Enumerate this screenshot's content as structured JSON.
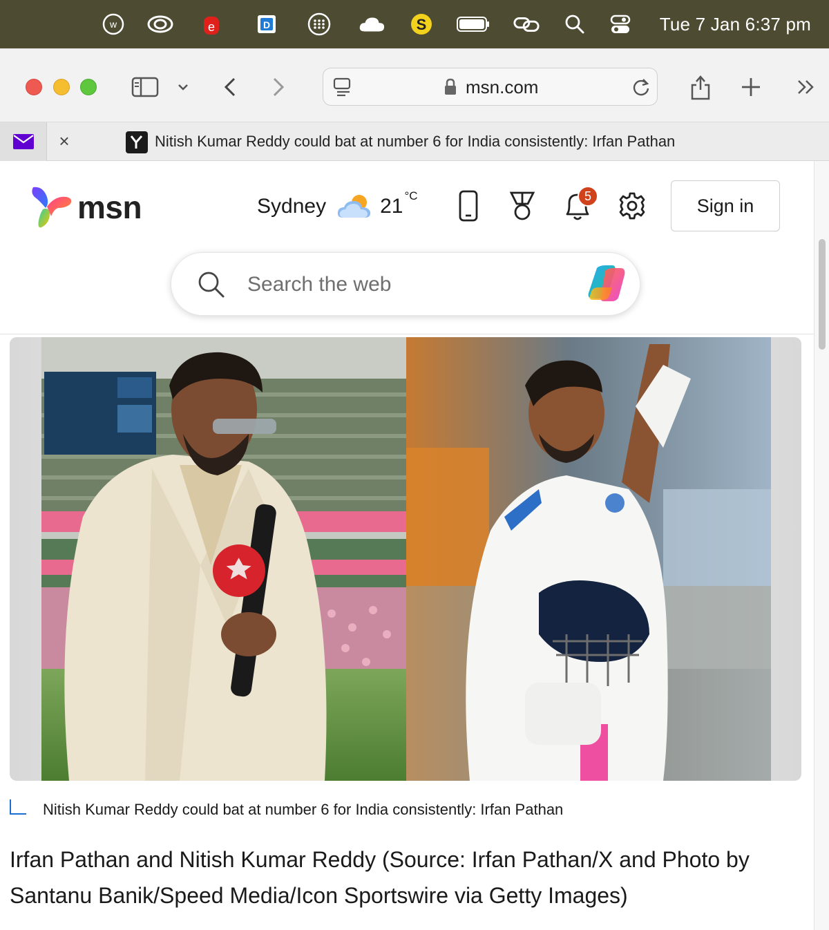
{
  "menubar": {
    "clock": "Tue 7 Jan  6:37 pm",
    "icons": [
      "w-circle-icon",
      "creative-cloud-icon",
      "e-red-icon",
      "d-blue-icon",
      "dots-grid-icon",
      "cloud-icon",
      "s-yellow-icon",
      "battery-icon",
      "link-icon",
      "spotlight-search-icon",
      "control-center-icon"
    ]
  },
  "browser": {
    "url": "msn.com",
    "tab_title": "Nitish Kumar Reddy could bat at number 6 for India consistently: Irfan Pathan",
    "close_glyph": "×"
  },
  "header": {
    "logo_text": "msn",
    "city": "Sydney",
    "temperature": "21",
    "temperature_unit": "°C",
    "notification_count": "5",
    "signin_label": "Sign in"
  },
  "search": {
    "placeholder": "Search the web"
  },
  "article": {
    "caption": "Nitish Kumar Reddy could bat at number 6 for India consistently: Irfan Pathan",
    "credit": "Irfan Pathan and Nitish Kumar Reddy (Source: Irfan Pathan/X and Photo by Santanu Banik/Speed Media/Icon Sportswire via Getty Images)"
  },
  "colors": {
    "menubar_bg": "#4d4b32",
    "notification_badge": "#d0421b",
    "caption_accent": "#1b6fd1"
  }
}
